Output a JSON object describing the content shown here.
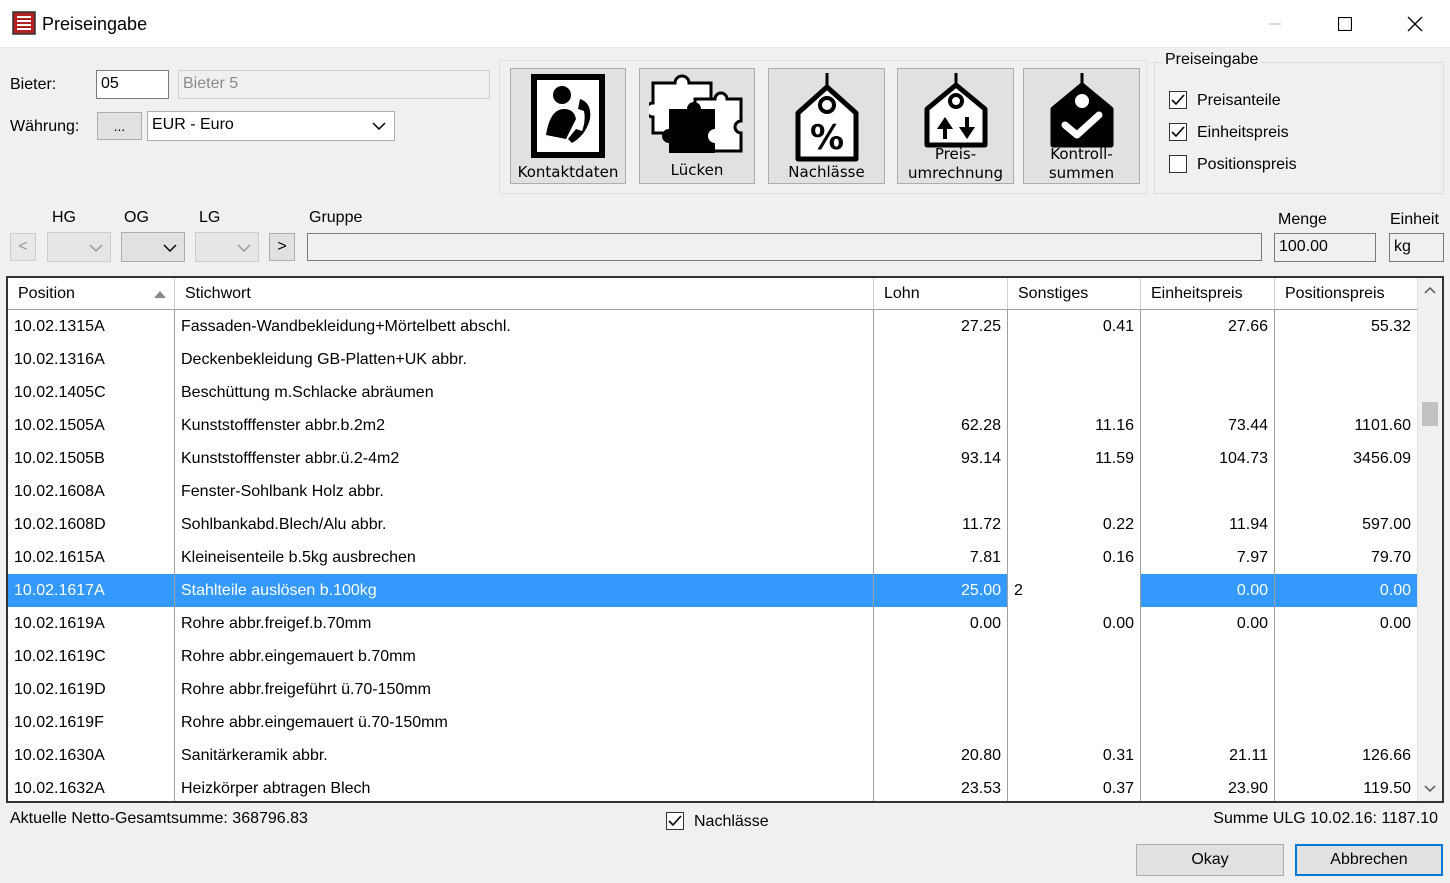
{
  "window": {
    "title": "Preiseingabe"
  },
  "bieter": {
    "label": "Bieter:",
    "code": "05",
    "name": "Bieter 5"
  },
  "waehrung": {
    "label": "Währung:",
    "browse_label": "...",
    "selected": "EUR - Euro"
  },
  "toolbar": {
    "kontaktdaten": "Kontaktdaten",
    "luecken": "Lücken",
    "nachlaesse": "Nachlässe",
    "preisumrechnung_1": "Preis-",
    "preisumrechnung_2": "umrechnung",
    "kontrollsummen_1": "Kontroll-",
    "kontrollsummen_2": "summen"
  },
  "preiseingabe_group": {
    "title": "Preiseingabe",
    "preisanteile": "Preisanteile",
    "einheitspreis": "Einheitspreis",
    "positionspreis": "Positionspreis"
  },
  "filters": {
    "hg": "HG",
    "og": "OG",
    "lg": "LG",
    "gruppe": "Gruppe",
    "prev": "<",
    "next": ">",
    "menge_label": "Menge",
    "menge_value": "100.00",
    "einheit_label": "Einheit",
    "einheit_value": "kg"
  },
  "table": {
    "columns": [
      "Position",
      "Stichwort",
      "Lohn",
      "Sonstiges",
      "Einheitspreis",
      "Positionspreis"
    ],
    "rows": [
      [
        "10.02.1315A",
        "Fassaden-Wandbekleidung+Mörtelbett abschl.",
        "27.25",
        "0.41",
        "27.66",
        "55.32"
      ],
      [
        "10.02.1316A",
        "Deckenbekleidung GB-Platten+UK abbr.",
        "",
        "",
        "",
        ""
      ],
      [
        "10.02.1405C",
        "Beschüttung m.Schlacke abräumen",
        "",
        "",
        "",
        ""
      ],
      [
        "10.02.1505A",
        "Kunststofffenster abbr.b.2m2",
        "62.28",
        "11.16",
        "73.44",
        "1101.60"
      ],
      [
        "10.02.1505B",
        "Kunststofffenster abbr.ü.2-4m2",
        "93.14",
        "11.59",
        "104.73",
        "3456.09"
      ],
      [
        "10.02.1608A",
        "Fenster-Sohlbank Holz abbr.",
        "",
        "",
        "",
        ""
      ],
      [
        "10.02.1608D",
        "Sohlbankabd.Blech/Alu abbr.",
        "11.72",
        "0.22",
        "11.94",
        "597.00"
      ],
      [
        "10.02.1615A",
        "Kleineisenteile b.5kg ausbrechen",
        "7.81",
        "0.16",
        "7.97",
        "79.70"
      ],
      [
        "10.02.1617A",
        "Stahlteile auslösen b.100kg",
        "25.00",
        "2",
        "0.00",
        "0.00"
      ],
      [
        "10.02.1619A",
        "Rohre abbr.freigef.b.70mm",
        "0.00",
        "0.00",
        "0.00",
        "0.00"
      ],
      [
        "10.02.1619C",
        "Rohre abbr.eingemauert b.70mm",
        "",
        "",
        "",
        ""
      ],
      [
        "10.02.1619D",
        "Rohre abbr.freigeführt ü.70-150mm",
        "",
        "",
        "",
        ""
      ],
      [
        "10.02.1619F",
        "Rohre abbr.eingemauert ü.70-150mm",
        "",
        "",
        "",
        ""
      ],
      [
        "10.02.1630A",
        "Sanitärkeramik abbr.",
        "20.80",
        "0.31",
        "21.11",
        "126.66"
      ],
      [
        "10.02.1632A",
        "Heizkörper abtragen Blech",
        "23.53",
        "0.37",
        "23.90",
        "119.50"
      ]
    ]
  },
  "footer": {
    "netto": "Aktuelle Netto-Gesamtsumme: 368796.83",
    "nachlaesse": "Nachlässe",
    "summe": "Summe ULG 10.02.16: 1187.10",
    "okay": "Okay",
    "abbrechen": "Abbrechen"
  },
  "colors": {
    "selection": "#3399ff",
    "default_button_border": "#0078d7"
  }
}
